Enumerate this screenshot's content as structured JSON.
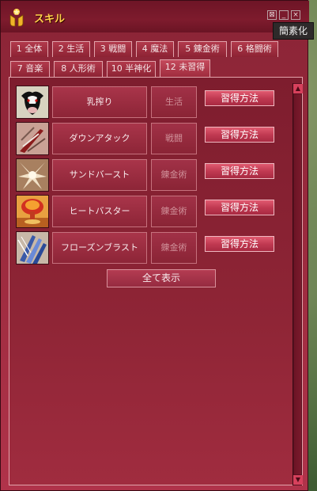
{
  "window": {
    "title": "スキル",
    "tooltip": "簡素化"
  },
  "tabs_row1": [
    {
      "num": "1",
      "label": "全体"
    },
    {
      "num": "2",
      "label": "生活"
    },
    {
      "num": "3",
      "label": "戦闘"
    },
    {
      "num": "4",
      "label": "魔法"
    },
    {
      "num": "5",
      "label": "錬金術"
    },
    {
      "num": "6",
      "label": "格闘術"
    }
  ],
  "tabs_row2": [
    {
      "num": "7",
      "label": "音楽"
    },
    {
      "num": "8",
      "label": "人形術"
    },
    {
      "num": "10",
      "label": "半神化"
    },
    {
      "num": "12",
      "label": "未習得",
      "active": true
    }
  ],
  "skills": [
    {
      "name": "乳搾り",
      "category": "生活",
      "button": "習得方法",
      "icon": "cow-icon"
    },
    {
      "name": "ダウンアタック",
      "category": "戦闘",
      "button": "習得方法",
      "icon": "sword-strike-icon"
    },
    {
      "name": "サンドバースト",
      "category": "錬金術",
      "button": "習得方法",
      "icon": "sand-burst-icon"
    },
    {
      "name": "ヒートバスター",
      "category": "錬金術",
      "button": "習得方法",
      "icon": "explosion-icon"
    },
    {
      "name": "フローズンブラスト",
      "category": "錬金術",
      "button": "習得方法",
      "icon": "ice-blast-icon"
    }
  ],
  "show_all_label": "全て表示",
  "colors": {
    "window_bg": "#9a2a3d",
    "title_text": "#ffd24a",
    "button_accent": "#d54a62"
  }
}
